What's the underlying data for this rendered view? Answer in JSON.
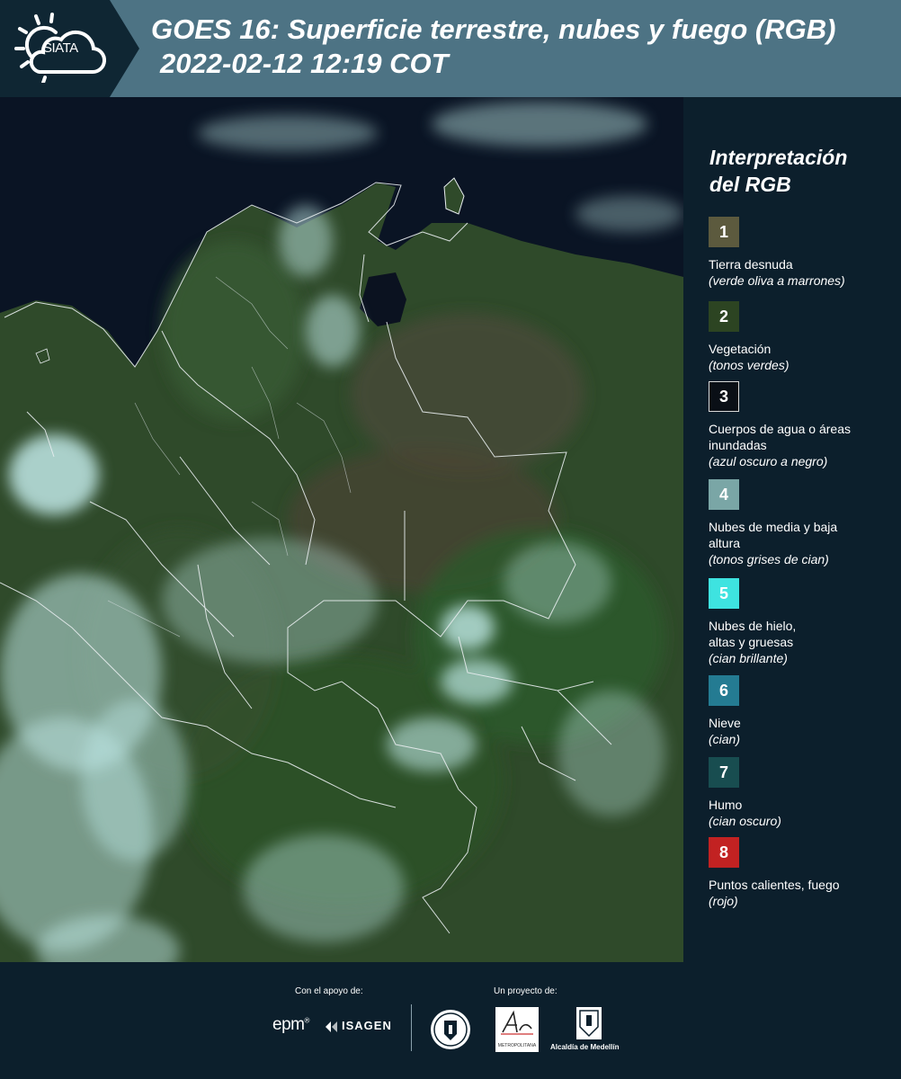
{
  "header": {
    "logo_text": "SIATA",
    "title_line1": "GOES 16: Superficie terrestre, nubes y fuego (RGB)",
    "title_line2": "2022-02-12 12:19 COT"
  },
  "legend": {
    "title_line1": "Interpretación",
    "title_line2": "del RGB",
    "items": [
      {
        "number": "1",
        "color": "#5c5a3e",
        "label": "Tierra desnuda",
        "sub": "(verde oliva a marrones)"
      },
      {
        "number": "2",
        "color": "#2c4422",
        "label": "Vegetación",
        "sub": "(tonos verdes)"
      },
      {
        "number": "3",
        "color": "#0a0f16",
        "label": "Cuerpos de agua o áreas inundadas",
        "sub": "(azul oscuro a negro)"
      },
      {
        "number": "4",
        "color": "#7aa6a6",
        "label": "Nubes de media y baja altura",
        "sub": "(tonos grises de cian)"
      },
      {
        "number": "5",
        "color": "#3ee3e0",
        "label": "Nubes de hielo, altas y gruesas",
        "sub": "(cian brillante)"
      },
      {
        "number": "6",
        "color": "#247b92",
        "label": "Nieve",
        "sub": "(cian)"
      },
      {
        "number": "7",
        "color": "#184d50",
        "label": "Humo",
        "sub": "(cian oscuro)"
      },
      {
        "number": "8",
        "color": "#c22222",
        "label": "Puntos calientes, fuego",
        "sub": "(rojo)"
      }
    ]
  },
  "footer": {
    "support_label": "Con el apoyo de:",
    "project_label": "Un proyecto de:",
    "epm": "epm",
    "isagen": "ISAGEN",
    "amva_text": "METROPOLITANA",
    "alcaldia": "Alcaldía de Medellín"
  }
}
